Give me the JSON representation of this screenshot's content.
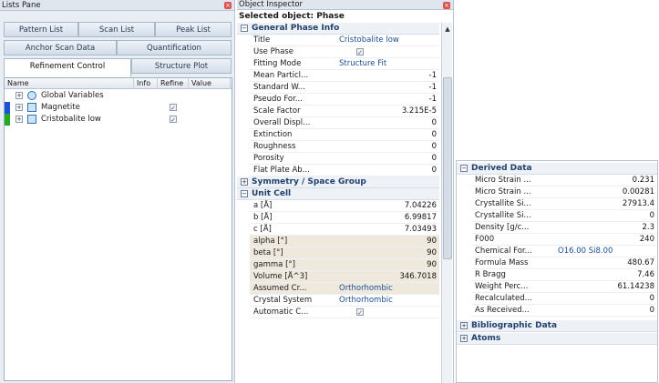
{
  "lists_pane": {
    "title": "Lists Pane",
    "tabs_row1": [
      "Pattern List",
      "Scan List",
      "Peak List"
    ],
    "tabs_row2": [
      "Anchor Scan Data",
      "Quantification"
    ],
    "tabs_row3": [
      "Refinement Control",
      "Structure Plot"
    ],
    "active_tab": "Refinement Control",
    "columns": [
      "Name",
      "Info",
      "Refine",
      "Value"
    ],
    "rows": [
      {
        "label": "Global Variables",
        "refine": false,
        "marker": ""
      },
      {
        "label": "Magnetite",
        "refine": true,
        "marker": "#1f4fd6"
      },
      {
        "label": "Cristobalite low",
        "refine": true,
        "marker": "#22aa22"
      }
    ]
  },
  "inspector": {
    "title": "Object Inspector",
    "selected_label": "Selected object: Phase",
    "general": {
      "heading": "General Phase Info",
      "rows": [
        {
          "name": "Title",
          "value": "Cristobalite low",
          "text": true
        },
        {
          "name": "Use Phase",
          "check": true
        },
        {
          "name": "Fitting Mode",
          "value": "Structure Fit",
          "text": true
        },
        {
          "name": "Mean Particl...",
          "value": "-1"
        },
        {
          "name": "Standard W...",
          "value": "-1"
        },
        {
          "name": "Pseudo For...",
          "value": "-1"
        },
        {
          "name": "Scale Factor",
          "value": "3.215E-5"
        },
        {
          "name": "Overall Displ...",
          "value": "0"
        },
        {
          "name": "Extinction",
          "value": "0"
        },
        {
          "name": "Roughness",
          "value": "0"
        },
        {
          "name": "Porosity",
          "value": "0"
        },
        {
          "name": "Flat Plate Ab...",
          "value": "0"
        }
      ]
    },
    "symmetry": {
      "heading": "Symmetry / Space Group"
    },
    "unit_cell": {
      "heading": "Unit Cell",
      "rows": [
        {
          "name": "a [Å]",
          "value": "7.04226"
        },
        {
          "name": "b [Å]",
          "value": "6.99817"
        },
        {
          "name": "c [Å]",
          "value": "7.03493"
        },
        {
          "name": "alpha [°]",
          "value": "90",
          "shade": true
        },
        {
          "name": "beta [°]",
          "value": "90",
          "shade": true
        },
        {
          "name": "gamma [°]",
          "value": "90",
          "shade": true
        },
        {
          "name": "Volume [Å^3]",
          "value": "346.7018",
          "shade": true
        },
        {
          "name": "Assumed Cr...",
          "value": "Orthorhombic",
          "text": true,
          "shade": true
        },
        {
          "name": "Crystal System",
          "value": "Orthorhombic",
          "text": true
        },
        {
          "name": "Automatic C...",
          "check": true
        }
      ]
    }
  },
  "derived": {
    "heading": "Derived Data",
    "rows": [
      {
        "name": "Micro Strain ...",
        "value": "0.231"
      },
      {
        "name": "Micro Strain ...",
        "value": "0.00281"
      },
      {
        "name": "Crystallite Si...",
        "value": "27913.4"
      },
      {
        "name": "Crystallite Si...",
        "value": "0"
      },
      {
        "name": "Density [g/c...",
        "value": "2.3"
      },
      {
        "name": "F000",
        "value": "240"
      },
      {
        "name": "Chemical For...",
        "value": "O16.00 Si8.00",
        "text": true
      },
      {
        "name": "Formula Mass",
        "value": "480.67"
      },
      {
        "name": "R Bragg",
        "value": "7.46"
      },
      {
        "name": "Weight Perc...",
        "value": "61.14238"
      },
      {
        "name": "Recalculated...",
        "value": "0"
      },
      {
        "name": "As Received...",
        "value": "0"
      }
    ],
    "bibliographic": "Bibliographic Data",
    "atoms": "Atoms"
  },
  "glyphs": {
    "plus": "+",
    "minus": "−",
    "check": "✓",
    "close": "×",
    "up": "▲"
  },
  "colors": {
    "accent": "#22406e",
    "shade": "#efe9dd",
    "pane_bg": "#e9eef4"
  }
}
